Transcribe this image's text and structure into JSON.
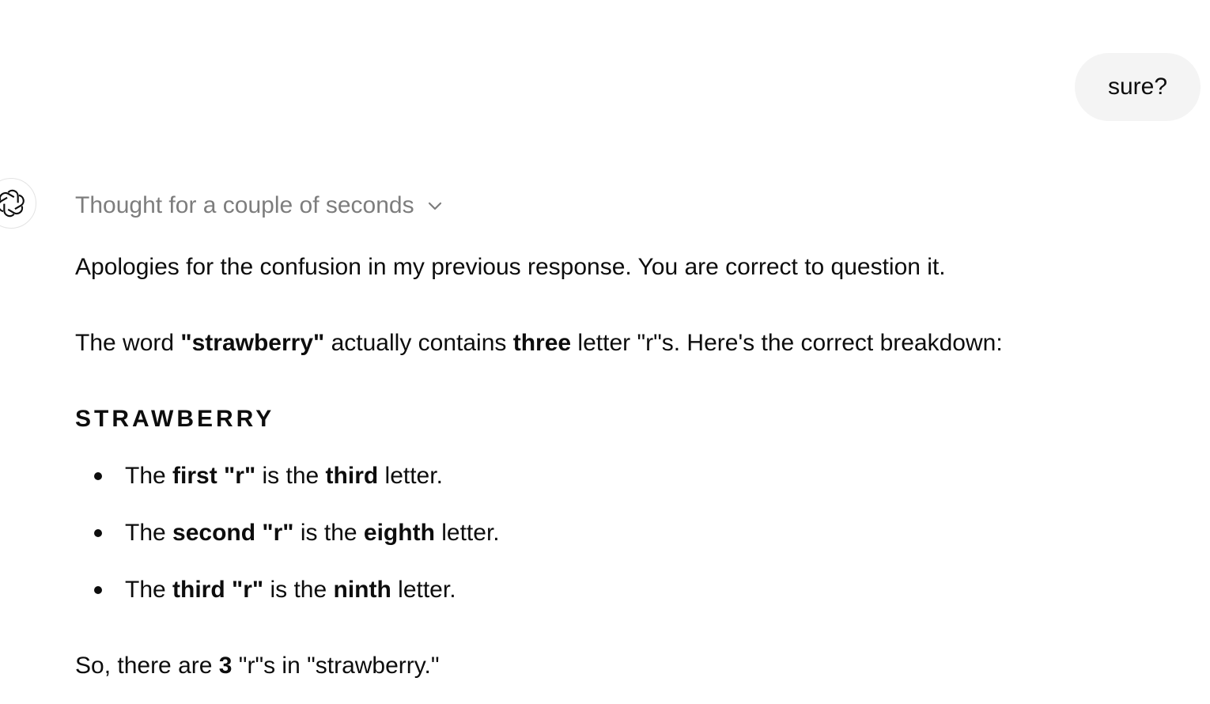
{
  "user_message": {
    "text": "sure?"
  },
  "assistant": {
    "avatar_icon": "openai-logo-icon",
    "thought_label": "Thought for a couple of seconds",
    "thought_toggle_icon": "chevron-down-icon",
    "paragraph1": "Apologies for the confusion in my previous response. You are correct to question it.",
    "paragraph2": {
      "t1": "The word ",
      "b1": "\"strawberry\"",
      "t2": " actually contains ",
      "b2": "three",
      "t3": " letter \"r\"s. Here's the correct breakdown:"
    },
    "heading": "STRAWBERRY",
    "bullets": [
      {
        "t1": "The ",
        "b1": "first \"r\"",
        "t2": " is the ",
        "b2": "third",
        "t3": " letter."
      },
      {
        "t1": "The ",
        "b1": "second \"r\"",
        "t2": " is the ",
        "b2": "eighth",
        "t3": " letter."
      },
      {
        "t1": "The ",
        "b1": "third \"r\"",
        "t2": " is the ",
        "b2": "ninth",
        "t3": " letter."
      }
    ],
    "conclusion": {
      "t1": "So, there are ",
      "b1": "3",
      "t2": " \"r\"s in \"strawberry.\""
    }
  },
  "colors": {
    "text": "#0d0d0d",
    "muted": "#7d7d7d",
    "user_bubble_bg": "#f4f4f4",
    "avatar_border": "#e3e3e3"
  }
}
